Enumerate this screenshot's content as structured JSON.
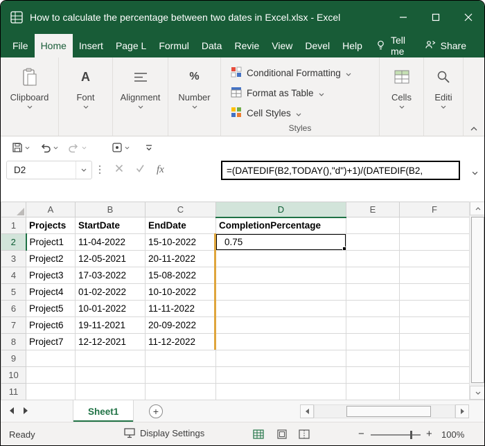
{
  "window": {
    "title": "How to calculate the percentage between two dates in Excel.xlsx - Excel"
  },
  "tabs": {
    "items": [
      "File",
      "Home",
      "Insert",
      "Page L",
      "Formul",
      "Data",
      "Revie",
      "View",
      "Devel",
      "Help"
    ],
    "tell_me": "Tell me",
    "share": "Share"
  },
  "ribbon": {
    "clipboard_label": "Clipboard",
    "font_label": "Font",
    "alignment_label": "Alignment",
    "number_label": "Number",
    "styles_label": "Styles",
    "conditional_formatting_label": "Conditional Formatting",
    "format_as_table_label": "Format as Table",
    "cell_styles_label": "Cell Styles",
    "cells_label": "Cells",
    "editing_label": "Editi"
  },
  "formula_bar": {
    "name_box": "D2",
    "formula": "=(DATEDIF(B2,TODAY(),\"d\")+1)/(DATEDIF(B2,"
  },
  "grid": {
    "column_headers": [
      "A",
      "B",
      "C",
      "D",
      "E",
      "F"
    ],
    "row_headers": [
      "1",
      "2",
      "3",
      "4",
      "5",
      "6",
      "7",
      "8",
      "9",
      "10",
      "11"
    ],
    "selected_cell": "D2",
    "selected_column": "D",
    "selected_row": "2",
    "rows": [
      [
        "Projects",
        "StartDate",
        "EndDate",
        "CompletionPercentage",
        "",
        ""
      ],
      [
        "Project1",
        "11-04-2022",
        "15-10-2022",
        "0.75",
        "",
        ""
      ],
      [
        "Project2",
        "12-05-2021",
        "20-11-2022",
        "",
        "",
        ""
      ],
      [
        "Project3",
        "17-03-2022",
        "15-08-2022",
        "",
        "",
        ""
      ],
      [
        "Project4",
        "01-02-2022",
        "10-10-2022",
        "",
        "",
        ""
      ],
      [
        "Project5",
        "10-01-2022",
        "11-11-2022",
        "",
        "",
        ""
      ],
      [
        "Project6",
        "19-11-2021",
        "20-09-2022",
        "",
        "",
        ""
      ],
      [
        "Project7",
        "12-12-2021",
        "11-12-2022",
        "",
        "",
        ""
      ],
      [
        "",
        "",
        "",
        "",
        "",
        ""
      ],
      [
        "",
        "",
        "",
        "",
        "",
        ""
      ],
      [
        "",
        "",
        "",
        "",
        "",
        ""
      ]
    ]
  },
  "sheet_tabs": {
    "active_tab": "Sheet1"
  },
  "status_bar": {
    "mode": "Ready",
    "display_settings": "Display Settings",
    "zoom_level": "100%"
  },
  "colors": {
    "titlebar_green": "#185C37",
    "accent_green": "#217346",
    "selection_border": "#000000",
    "marker_orange": "#DFA53C"
  }
}
